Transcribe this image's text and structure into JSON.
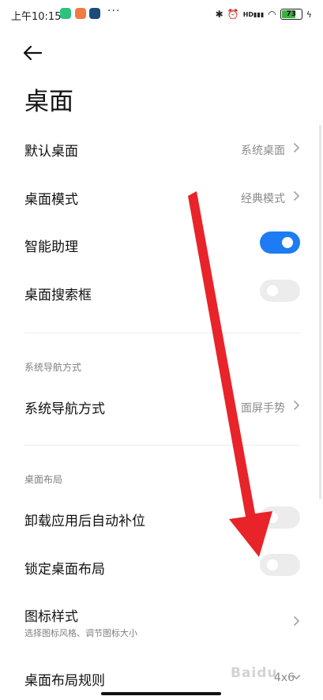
{
  "status_bar": {
    "time": "上午10:15",
    "dots": "···",
    "signal_label": "HD",
    "battery": "73"
  },
  "page": {
    "title": "桌面"
  },
  "rows": {
    "default_desktop": {
      "label": "默认桌面",
      "value": "系统桌面"
    },
    "desktop_mode": {
      "label": "桌面模式",
      "value": "经典模式"
    },
    "smart_assistant": {
      "label": "智能助理",
      "on": true
    },
    "desktop_search": {
      "label": "桌面搜索框",
      "on": false
    },
    "nav_method": {
      "label": "系统导航方式",
      "value": "面屏手势"
    },
    "auto_fill": {
      "label": "卸载应用后自动补位",
      "on": false
    },
    "lock_layout": {
      "label": "锁定桌面布局",
      "on": false
    },
    "icon_style": {
      "label": "图标样式",
      "sub": "选择图标风格、调节图标大小"
    },
    "layout_rule": {
      "label": "桌面布局规则",
      "value": "4x6"
    }
  },
  "sections": {
    "navigation": "系统导航方式",
    "layout": "桌面布局"
  },
  "watermark": "Baidu",
  "colors": {
    "accent": "#1e7cf2",
    "arrow": "#e8232a"
  }
}
